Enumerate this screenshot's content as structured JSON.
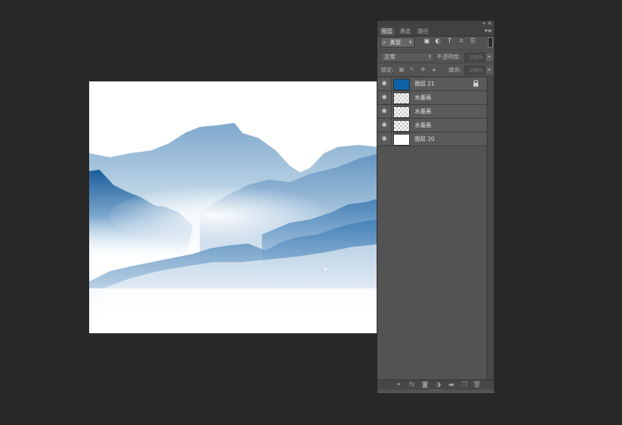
{
  "panel": {
    "topbar": {
      "collapse_glyph": "«",
      "close_glyph": "×"
    },
    "tabs": [
      {
        "label": "图层",
        "active": true
      },
      {
        "label": "通道",
        "active": false
      },
      {
        "label": "路径",
        "active": false
      }
    ],
    "menu_glyph": "▾≡",
    "filter": {
      "kind_label": "类型",
      "icons": [
        "image-filter-icon",
        "adjustment-filter-icon",
        "type-filter-icon",
        "shape-filter-icon",
        "smart-object-filter-icon"
      ]
    },
    "blend_mode": "正常",
    "opacity_label": "不透明度:",
    "opacity_value": "100%",
    "lock_label": "锁定:",
    "fill_label": "填充:",
    "fill_value": "100%",
    "layers": [
      {
        "name": "图层 21",
        "thumbnail": "blue",
        "locked": true
      },
      {
        "name": "水墨画",
        "thumbnail": "transparent",
        "locked": false
      },
      {
        "name": "水墨画",
        "thumbnail": "transparent",
        "locked": false
      },
      {
        "name": "水墨画",
        "thumbnail": "transparent",
        "locked": false
      },
      {
        "name": "图层 20",
        "thumbnail": "white",
        "locked": false
      }
    ],
    "bottom_icons": [
      "link-layers-icon",
      "fx-icon",
      "add-mask-icon",
      "adjustment-layer-icon",
      "new-group-icon",
      "new-layer-icon",
      "delete-layer-icon"
    ]
  },
  "colors": {
    "background": "#282828",
    "panel": "#535353",
    "layer_21_fill": "#0e62a8",
    "ink_blue": "#1f65a3"
  }
}
